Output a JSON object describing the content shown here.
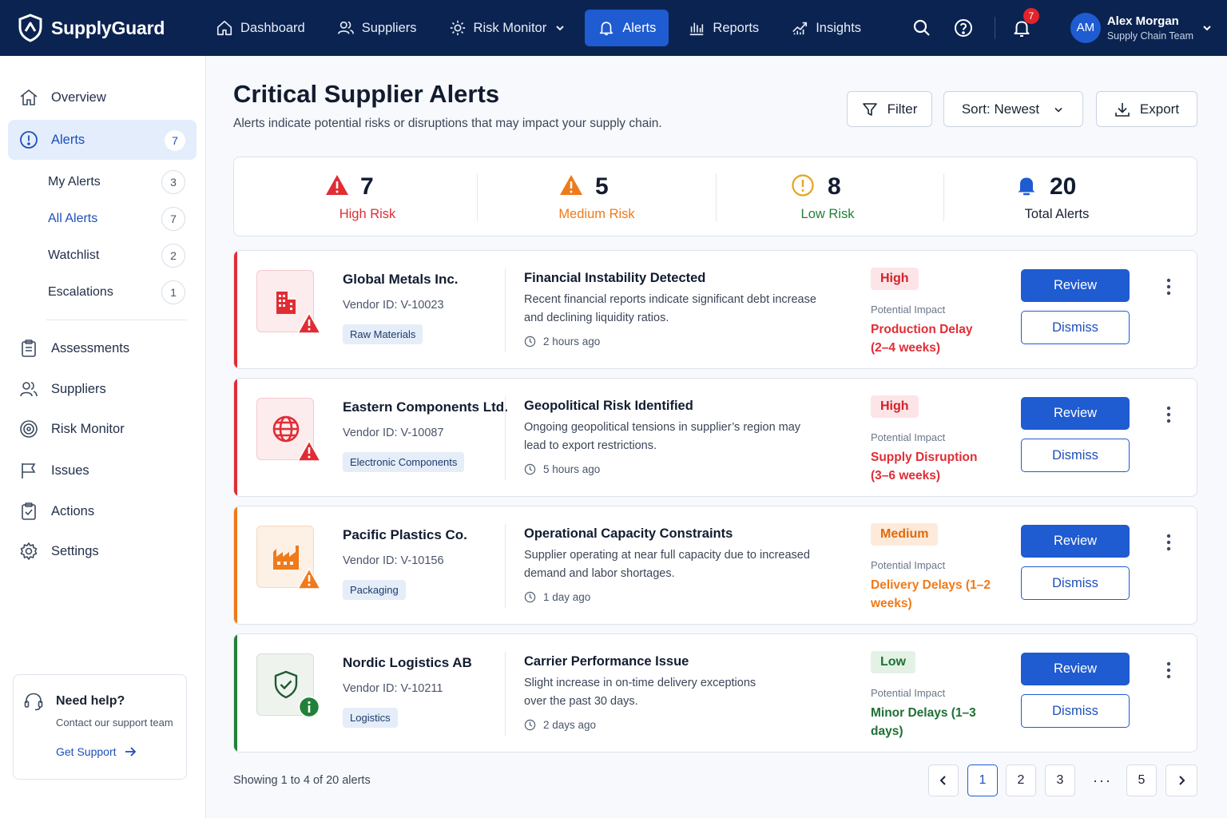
{
  "app": {
    "name": "SupplyGuard"
  },
  "topnav": {
    "items": [
      {
        "label": "Dashboard",
        "icon": "home-icon"
      },
      {
        "label": "Suppliers",
        "icon": "users-icon"
      },
      {
        "label": "Risk Monitor",
        "icon": "gear-icon"
      },
      {
        "label": "Alerts",
        "icon": "bell-icon",
        "active": true
      },
      {
        "label": "Reports",
        "icon": "bar-chart-icon"
      },
      {
        "label": "Insights",
        "icon": "trend-icon"
      }
    ],
    "notifications_count": "7",
    "user": {
      "initials": "AM",
      "name": "Alex Morgan",
      "team": "Supply Chain Team"
    }
  },
  "sidebar": {
    "overview": "Overview",
    "alerts": {
      "label": "Alerts",
      "count": "7"
    },
    "sub": [
      {
        "label": "My Alerts",
        "count": "3"
      },
      {
        "label": "All Alerts",
        "count": "7",
        "active": true
      },
      {
        "label": "Watchlist",
        "count": "2"
      },
      {
        "label": "Escalations",
        "count": "1"
      }
    ],
    "items": [
      {
        "label": "Assessments"
      },
      {
        "label": "Suppliers"
      },
      {
        "label": "Risk Monitor"
      },
      {
        "label": "Issues"
      },
      {
        "label": "Actions"
      },
      {
        "label": "Settings"
      }
    ],
    "help": {
      "title": "Need help?",
      "subtitle": "Contact our support team",
      "link": "Get Support"
    }
  },
  "page": {
    "title": "Critical Supplier Alerts",
    "subtitle": "Alerts indicate potential risks or disruptions that may impact your supply chain.",
    "filter_label": "Filter",
    "sort_label": "Sort: Newest",
    "export_label": "Export"
  },
  "stats": [
    {
      "value": "7",
      "label": "High Risk",
      "color": "#e02d35"
    },
    {
      "value": "5",
      "label": "Medium Risk",
      "color": "#ef7a1a"
    },
    {
      "value": "8",
      "label": "Low Risk",
      "color": "#23803a"
    },
    {
      "value": "20",
      "label": "Total Alerts",
      "color": "#1f5bd1"
    }
  ],
  "alerts": [
    {
      "supplier": "Global Metals Inc.",
      "vendor_id": "Vendor ID: V-10023",
      "category": "Raw Materials",
      "title": "Financial Instability Detected",
      "description": "Recent financial reports indicate significant debt increase and declining liquidity ratios.",
      "time": "2 hours ago",
      "severity": "High",
      "impact_label": "Potential Impact",
      "impact": "Production Delay (2–4 weeks)",
      "icon": "building-icon",
      "review": "Review",
      "dismiss": "Dismiss"
    },
    {
      "supplier": "Eastern Components Ltd.",
      "vendor_id": "Vendor ID: V-10087",
      "category": "Electronic Components",
      "title": "Geopolitical Risk Identified",
      "description": "Ongoing geopolitical tensions in supplier’s region may lead to export restrictions.",
      "time": "5 hours ago",
      "severity": "High",
      "impact_label": "Potential Impact",
      "impact": "Supply Disruption (3–6 weeks)",
      "icon": "globe-icon",
      "review": "Review",
      "dismiss": "Dismiss"
    },
    {
      "supplier": "Pacific Plastics Co.",
      "vendor_id": "Vendor ID: V-10156",
      "category": "Packaging",
      "title": "Operational Capacity Constraints",
      "description": "Supplier operating at near full capacity due to increased demand and labor shortages.",
      "time": "1 day ago",
      "severity": "Medium",
      "impact_label": "Potential Impact",
      "impact": "Delivery Delays (1–2 weeks)",
      "icon": "factory-icon",
      "review": "Review",
      "dismiss": "Dismiss"
    },
    {
      "supplier": "Nordic Logistics AB",
      "vendor_id": "Vendor ID: V-10211",
      "category": "Logistics",
      "title": "Carrier Performance Issue",
      "description": "Slight increase in on-time delivery exceptions over the past 30 days.",
      "time": "2 days ago",
      "severity": "Low",
      "impact_label": "Potential Impact",
      "impact": "Minor Delays (1–3 days)",
      "icon": "shield-check-icon",
      "review": "Review",
      "dismiss": "Dismiss"
    }
  ],
  "pagination": {
    "showing": "Showing 1 to 4 of 20 alerts",
    "pages": [
      "1",
      "2",
      "3",
      "5"
    ],
    "ellipsis": "···",
    "current": "1"
  }
}
